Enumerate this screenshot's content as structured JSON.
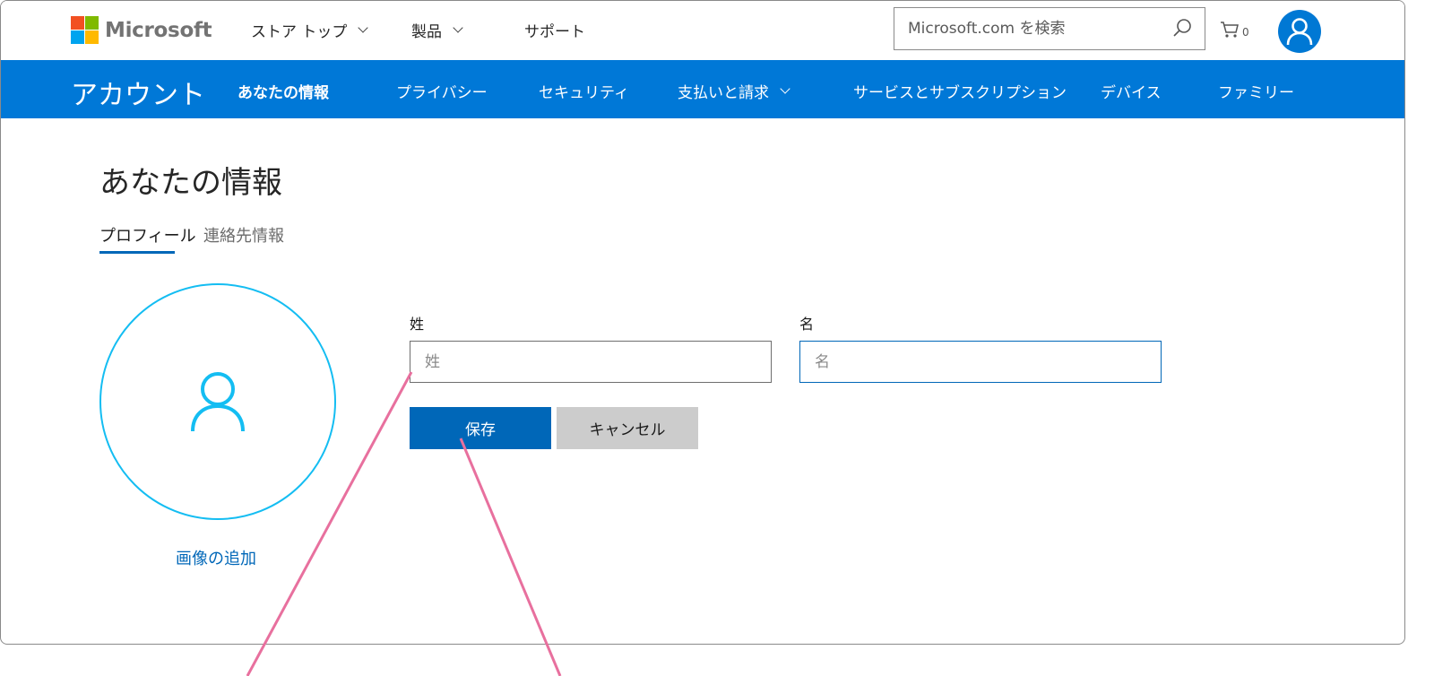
{
  "header": {
    "brand": "Microsoft",
    "nav": [
      {
        "label": "ストア トップ",
        "has_dropdown": true
      },
      {
        "label": "製品",
        "has_dropdown": true
      },
      {
        "label": "サポート",
        "has_dropdown": false
      }
    ],
    "search": {
      "placeholder": "Microsoft.com を検索",
      "value": ""
    },
    "cart_count": "0"
  },
  "account_nav": {
    "title": "アカウント",
    "items": [
      {
        "label": "あなたの情報",
        "active": true
      },
      {
        "label": "プライバシー"
      },
      {
        "label": "セキュリティ"
      },
      {
        "label": "支払いと請求",
        "has_dropdown": true
      },
      {
        "label": "サービスとサブスクリプション"
      },
      {
        "label": "デバイス"
      },
      {
        "label": "ファミリー"
      }
    ]
  },
  "main": {
    "title": "あなたの情報",
    "tabs": [
      {
        "label": "プロフィール",
        "active": true
      },
      {
        "label": "連絡先情報",
        "active": false
      }
    ],
    "profile": {
      "add_image_label": "画像の追加"
    },
    "form": {
      "last_name": {
        "label": "姓",
        "placeholder": "姓",
        "value": ""
      },
      "first_name": {
        "label": "名",
        "placeholder": "名",
        "value": ""
      },
      "save_label": "保存",
      "cancel_label": "キャンセル"
    }
  },
  "colors": {
    "accent": "#0078d7",
    "button_primary": "#0067b8",
    "profile_ring": "#14bdf2",
    "annotation_line": "#e8709e"
  }
}
